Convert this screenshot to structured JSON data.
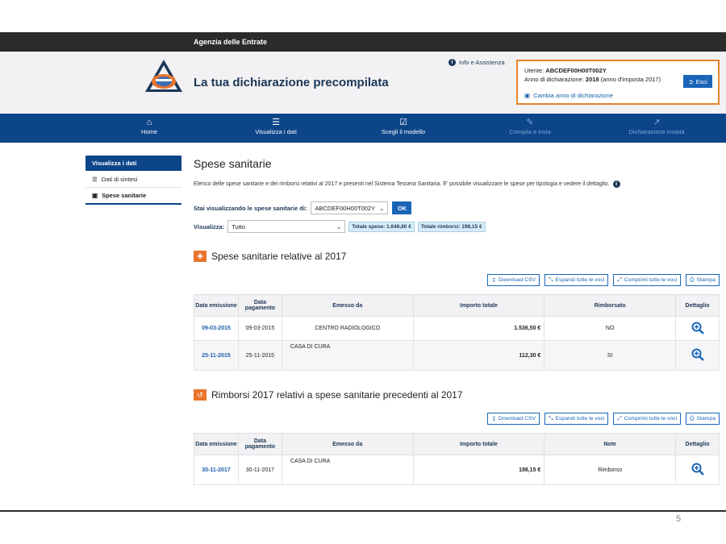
{
  "topbar": {
    "agency": "Agenzia delle Entrate"
  },
  "header": {
    "site_title": "La tua dichiarazione precompilata",
    "info_link": "Info e Assistenza",
    "user_label": "Utente:",
    "user_code": "ABCDEF00H00T002Y",
    "year_label": "Anno di dichiarazione:",
    "year_value": "2018",
    "year_note": "(anno d'imposta 2017)",
    "change_year": "Cambia anno di dichiarazione",
    "exit_button": "Esci"
  },
  "nav": {
    "items": [
      {
        "label": "Home",
        "icon": "home-icon",
        "enabled": true
      },
      {
        "label": "Visualizza i dati",
        "icon": "list-icon",
        "enabled": true
      },
      {
        "label": "Scegli il modello",
        "icon": "checkbox-icon",
        "enabled": true
      },
      {
        "label": "Compila e invia",
        "icon": "edit-icon",
        "enabled": false
      },
      {
        "label": "Dichiarazione inviata",
        "icon": "share-icon",
        "enabled": false
      }
    ]
  },
  "sidebar": {
    "heading": "Visualizza i dati",
    "items": [
      {
        "label": "Dati di sintesi",
        "icon": "list-icon"
      },
      {
        "label": "Spese sanitarie",
        "icon": "medkit-icon",
        "active": true
      }
    ]
  },
  "main": {
    "title": "Spese sanitarie",
    "description": "Elenco delle spese sanitarie e dei rimborsi relativi al 2017 e presenti nel Sistema Tessera Sanitaria. E' possibile visualizzare le spese per tipologia e vedere il dettaglio.",
    "viewing_label": "Stai visualizzando le spese sanitarie di:",
    "viewing_value": "ABCDEF00H00T002Y",
    "ok_button": "OK",
    "filter_label": "Visualizza:",
    "filter_value": "Tutto",
    "total_expenses": "Totale spese: 1.648,80 €",
    "total_refunds": "Totale rimborsi: 198,15 €"
  },
  "toolbar": {
    "download": "Download CSV",
    "expand": "Espandi tutte le voci",
    "collapse": "Comprimi tutte le voci",
    "print": "Stampa"
  },
  "section1": {
    "title": "Spese sanitarie relative al 2017",
    "headers": [
      "Data emissione",
      "Data pagamento",
      "Emesso da",
      "Importo totale",
      "Rimborsato",
      "Dettaglio"
    ],
    "rows": [
      {
        "emission": "09-03-2015",
        "payment": "09-03-2015",
        "issuer": "CENTRO RADIOLOGICO",
        "amount": "1.536,50 €",
        "refunded": "NO"
      },
      {
        "emission": "25-11-2015",
        "payment": "25-11-2015",
        "issuer": "CASA DI CURA",
        "amount": "112,30 €",
        "refunded": "SI"
      }
    ]
  },
  "section2": {
    "title": "Rimborsi 2017 relativi a spese sanitarie precedenti al 2017",
    "headers": [
      "Data emissione",
      "Data pagamento",
      "Emesso da",
      "Importo totale",
      "Note",
      "Dettaglio"
    ],
    "rows": [
      {
        "emission": "30-11-2017",
        "payment": "30-11-2017",
        "issuer": "CASA DI CURA",
        "amount": "198,15 €",
        "note": "Rimborso"
      }
    ]
  },
  "slide": {
    "page_number": "5"
  },
  "colors": {
    "nav_blue": "#0d4589",
    "accent_orange": "#e8752b",
    "link_blue": "#1a5fa8"
  }
}
